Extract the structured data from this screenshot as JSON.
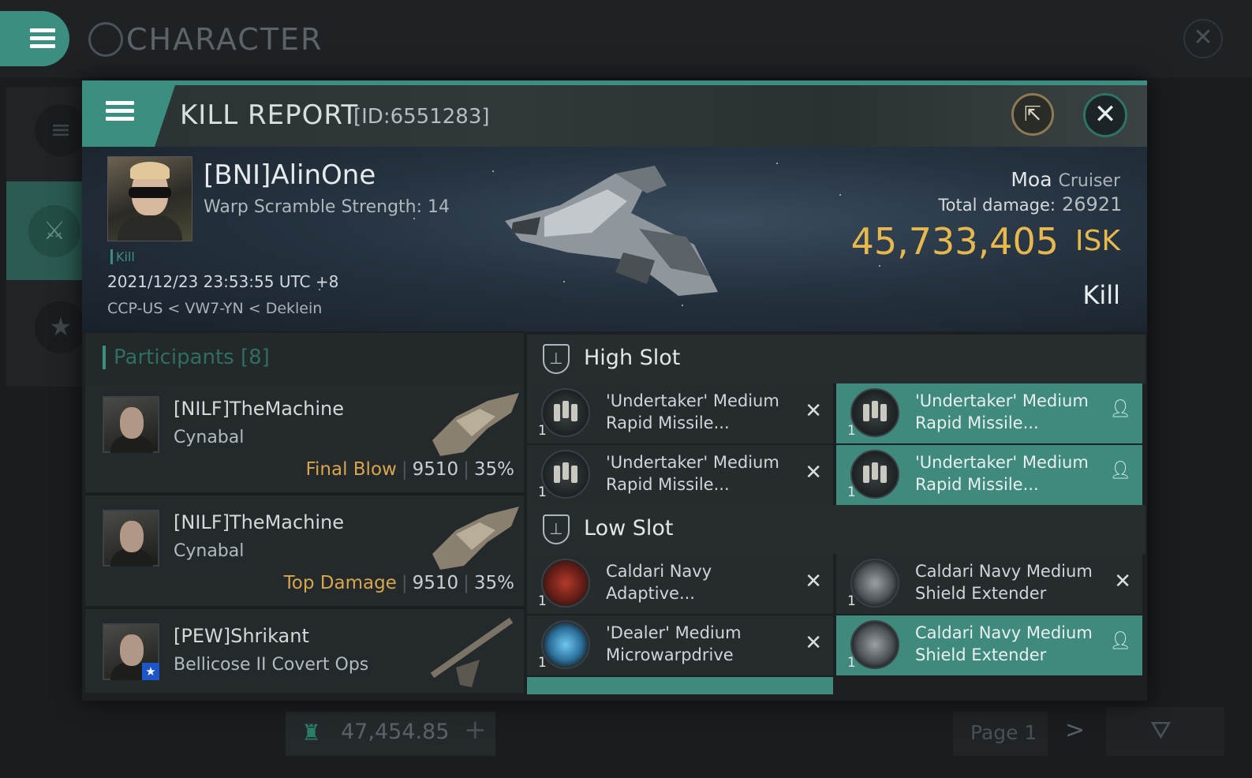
{
  "app": {
    "title": "CHARACTER",
    "balance": "47,454.85",
    "page_label": "Page 1"
  },
  "report": {
    "title": "KILL REPORT",
    "id": "[ID:6551283]",
    "victim": {
      "name": "[BNI]AlinOne",
      "warp_scramble": "Warp Scramble Strength: 14",
      "tag": "Kill",
      "datetime": "2021/12/23 23:53:55 UTC +8",
      "location": "CCP-US < VW7-YN < Deklein"
    },
    "ship": {
      "name": "Moa",
      "class": "Cruiser",
      "total_damage_label": "Total damage:",
      "total_damage": "26921",
      "isk_value": "45,733,405",
      "isk_unit": "ISK",
      "result": "Kill"
    }
  },
  "participants": {
    "title": "Participants",
    "count": "[8]",
    "rows": [
      {
        "name": "[NILF]TheMachine",
        "ship": "Cynabal",
        "tag": "Final Blow",
        "damage": "9510",
        "pct": "35%"
      },
      {
        "name": "[NILF]TheMachine",
        "ship": "Cynabal",
        "tag": "Top Damage",
        "damage": "9510",
        "pct": "35%"
      },
      {
        "name": "[PEW]Shrikant",
        "ship": "Bellicose II Covert Ops",
        "tag": "",
        "damage": "",
        "pct": ""
      }
    ]
  },
  "fitting": {
    "high_slot": {
      "title": "High Slot",
      "modules": [
        {
          "name_l1": "'Undertaker' Medium",
          "name_l2": "Rapid Missile...",
          "qty": "1",
          "state": "destroyed"
        },
        {
          "name_l1": "'Undertaker' Medium",
          "name_l2": "Rapid Missile...",
          "qty": "1",
          "state": "dropped"
        },
        {
          "name_l1": "'Undertaker' Medium",
          "name_l2": "Rapid Missile...",
          "qty": "1",
          "state": "destroyed"
        },
        {
          "name_l1": "'Undertaker' Medium",
          "name_l2": "Rapid Missile...",
          "qty": "1",
          "state": "dropped"
        }
      ]
    },
    "low_slot": {
      "title": "Low Slot",
      "modules": [
        {
          "name_l1": "Caldari Navy",
          "name_l2": "Adaptive...",
          "qty": "1",
          "state": "destroyed"
        },
        {
          "name_l1": "Caldari Navy Medium",
          "name_l2": "Shield Extender",
          "qty": "1",
          "state": "destroyed"
        },
        {
          "name_l1": "'Dealer' Medium",
          "name_l2": "Microwarpdrive",
          "qty": "1",
          "state": "destroyed"
        },
        {
          "name_l1": "Caldari Navy Medium",
          "name_l2": "Shield Extender",
          "qty": "1",
          "state": "dropped"
        }
      ]
    }
  },
  "colors": {
    "accent": "#3c8f80",
    "isk": "#e6b84e",
    "tag": "#d9a54e"
  }
}
